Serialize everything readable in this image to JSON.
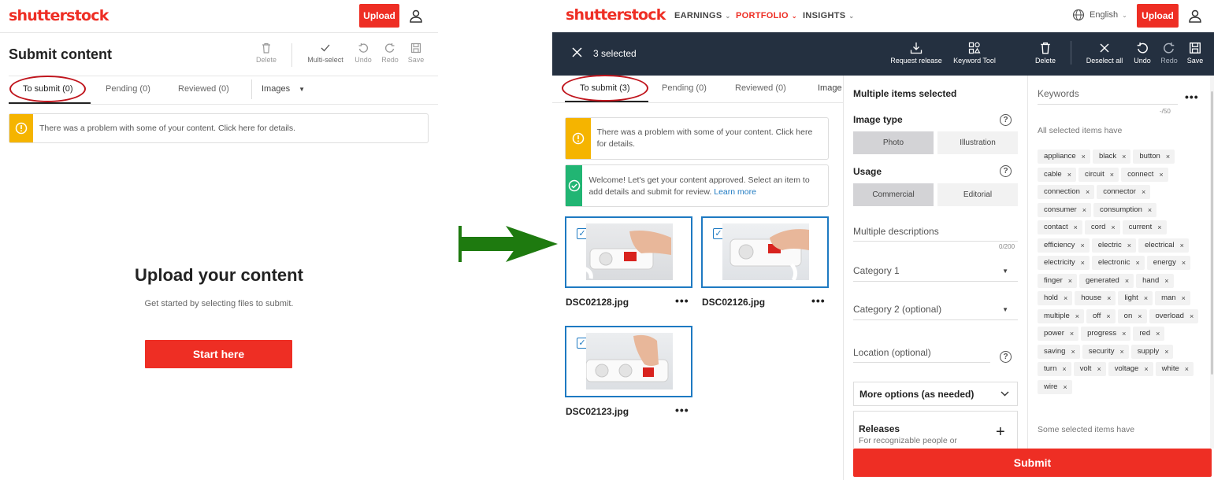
{
  "left": {
    "logo": "shutterstock",
    "upload_label": "Upload",
    "title": "Submit content",
    "toolbar": [
      {
        "label": "Delete",
        "icon": "trash-icon"
      },
      {
        "label": "Multi-select",
        "icon": "check-icon"
      },
      {
        "label": "Undo",
        "icon": "undo-icon"
      },
      {
        "label": "Redo",
        "icon": "redo-icon"
      },
      {
        "label": "Save",
        "icon": "save-icon"
      }
    ],
    "tabs": [
      "To submit (0)",
      "Pending (0)",
      "Reviewed (0)"
    ],
    "media_select": "Images",
    "alert": "There was a problem with some of your content. Click here for details.",
    "empty_title": "Upload your content",
    "empty_sub": "Get started by selecting files to submit.",
    "start_label": "Start here"
  },
  "right": {
    "logo": "shutterstock",
    "nav": [
      "EARNINGS",
      "PORTFOLIO",
      "INSIGHTS"
    ],
    "language": "English",
    "upload_label": "Upload",
    "selected_count": "3 selected",
    "toolbar": [
      {
        "label": "Request release",
        "icon": "download-icon"
      },
      {
        "label": "Keyword Tool",
        "icon": "keyword-tool-icon"
      },
      {
        "label": "Delete",
        "icon": "trash-icon"
      },
      {
        "label": "Deselect all",
        "icon": "close-icon"
      },
      {
        "label": "Undo",
        "icon": "undo-icon"
      },
      {
        "label": "Redo",
        "icon": "redo-icon"
      },
      {
        "label": "Save",
        "icon": "save-icon"
      }
    ],
    "tabs": [
      "To submit (3)",
      "Pending (0)",
      "Reviewed (0)",
      "Image"
    ],
    "alert_problem": "There was a problem with some of your content. Click here for details.",
    "alert_welcome": "Welcome! Let's get your content approved. Select an item to add details and submit for review.",
    "alert_welcome_link": "Learn more",
    "files": [
      "DSC02128.jpg",
      "DSC02126.jpg",
      "DSC02123.jpg"
    ],
    "panel": {
      "title": "Multiple items selected",
      "image_type_label": "Image type",
      "image_type_options": [
        "Photo",
        "Illustration"
      ],
      "usage_label": "Usage",
      "usage_options": [
        "Commercial",
        "Editorial"
      ],
      "descriptions_label": "Multiple descriptions",
      "descriptions_count": "0/200",
      "category1": "Category 1",
      "category2": "Category 2 (optional)",
      "location": "Location (optional)",
      "more_options": "More options (as needed)",
      "releases_title": "Releases",
      "releases_sub": "For recognizable people or"
    },
    "keywords": {
      "placeholder": "Keywords",
      "count": "-/50",
      "all_have": "All selected items have",
      "some_have": "Some selected items have",
      "tags": [
        "appliance",
        "black",
        "button",
        "cable",
        "circuit",
        "connect",
        "connection",
        "connector",
        "consumer",
        "consumption",
        "contact",
        "cord",
        "current",
        "efficiency",
        "electric",
        "electrical",
        "electricity",
        "electronic",
        "energy",
        "finger",
        "generated",
        "hand",
        "hold",
        "house",
        "light",
        "man",
        "multiple",
        "off",
        "on",
        "overload",
        "power",
        "progress",
        "red",
        "saving",
        "security",
        "supply",
        "turn",
        "volt",
        "voltage",
        "white",
        "wire"
      ]
    },
    "submit_label": "Submit"
  },
  "colors": {
    "brand": "#ee2e24",
    "dark_bar": "#243040",
    "arrow": "#1e7a0f",
    "selection": "#1e7ac2",
    "warning": "#f5b400",
    "success": "#21b573"
  }
}
